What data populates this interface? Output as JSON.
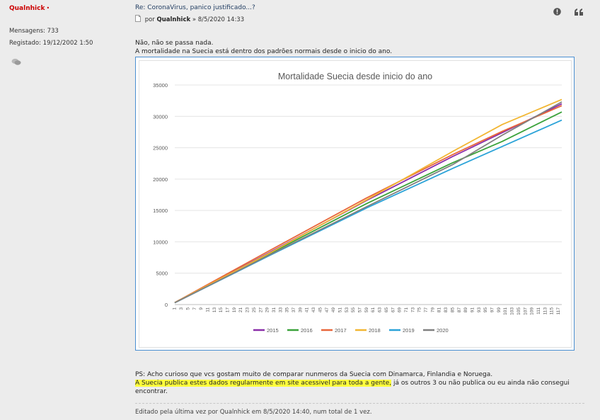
{
  "sidebar": {
    "username": "Qualnhick",
    "online_dot": "•",
    "messages_label": "Mensagens:",
    "messages_value": "733",
    "registered_label": "Registado:",
    "registered_value": "19/12/2002 1:50",
    "message_icon": "speech-bubbles-icon"
  },
  "post": {
    "title": "Re: CoronaVirus, panico justificado...?",
    "by_label": "por",
    "author": "Qualnhick",
    "separator": "»",
    "date": "8/5/2020 14:33",
    "icons": [
      "report-icon",
      "quote-icon"
    ],
    "line1": "Não, não se passa nada.",
    "line2": "A mortalidade na Suecia está dentro dos padrões normais desde o inicio do ano.",
    "ps_line1": "PS: Acho curioso que vcs gostam muito de comparar nunmeros da Suecia com Dinamarca, Finlandia e Noruega.",
    "ps_highlight": "A Suecia publica estes dados regularmente em site acessivel para toda a gente,",
    "ps_rest": " já os outros 3 ou não publica ou eu ainda não consegui",
    "ps_line3": "encontrar.",
    "edited": "Editado pela última vez por Qualnhick em 8/5/2020 14:40, num total de 1 vez."
  },
  "chart_data": {
    "type": "line",
    "title": "Mortalidade Suecia desde inicio do ano",
    "xlabel": "",
    "ylabel": "",
    "ylim": [
      0,
      35000
    ],
    "yticks": [
      0,
      5000,
      10000,
      15000,
      20000,
      25000,
      30000,
      35000
    ],
    "x_range": [
      1,
      118
    ],
    "xticks": [
      1,
      3,
      5,
      7,
      9,
      11,
      13,
      15,
      17,
      19,
      21,
      23,
      25,
      27,
      29,
      31,
      33,
      35,
      37,
      39,
      41,
      43,
      45,
      47,
      49,
      51,
      53,
      55,
      57,
      59,
      61,
      63,
      65,
      67,
      69,
      71,
      73,
      75,
      77,
      79,
      81,
      83,
      85,
      87,
      89,
      91,
      93,
      95,
      97,
      99,
      101,
      103,
      105,
      107,
      109,
      111,
      113,
      115,
      117
    ],
    "grid": "horizontal",
    "legend_position": "bottom",
    "series": [
      {
        "name": "2015",
        "color": "#8a2da8",
        "points": [
          [
            1,
            300
          ],
          [
            30,
            8400
          ],
          [
            59,
            16600
          ],
          [
            85,
            23600
          ],
          [
            100,
            27400
          ],
          [
            118,
            32000
          ]
        ]
      },
      {
        "name": "2016",
        "color": "#3aa23a",
        "points": [
          [
            1,
            300
          ],
          [
            30,
            8200
          ],
          [
            59,
            16100
          ],
          [
            85,
            22600
          ],
          [
            100,
            26000
          ],
          [
            118,
            30700
          ]
        ]
      },
      {
        "name": "2017",
        "color": "#e8663a",
        "points": [
          [
            1,
            320
          ],
          [
            30,
            8700
          ],
          [
            59,
            17000
          ],
          [
            85,
            23900
          ],
          [
            100,
            27600
          ],
          [
            118,
            31700
          ]
        ]
      },
      {
        "name": "2018",
        "color": "#f2b632",
        "points": [
          [
            1,
            300
          ],
          [
            30,
            8300
          ],
          [
            59,
            16700
          ],
          [
            85,
            24400
          ],
          [
            100,
            28700
          ],
          [
            118,
            32700
          ]
        ]
      },
      {
        "name": "2019",
        "color": "#2ba3d8",
        "points": [
          [
            1,
            280
          ],
          [
            30,
            7900
          ],
          [
            59,
            15400
          ],
          [
            85,
            21700
          ],
          [
            100,
            25200
          ],
          [
            118,
            29400
          ]
        ]
      },
      {
        "name": "2020",
        "color": "#808080",
        "points": [
          [
            1,
            280
          ],
          [
            30,
            8000
          ],
          [
            59,
            15600
          ],
          [
            85,
            22300
          ],
          [
            100,
            27000
          ],
          [
            118,
            32300
          ]
        ]
      }
    ]
  }
}
